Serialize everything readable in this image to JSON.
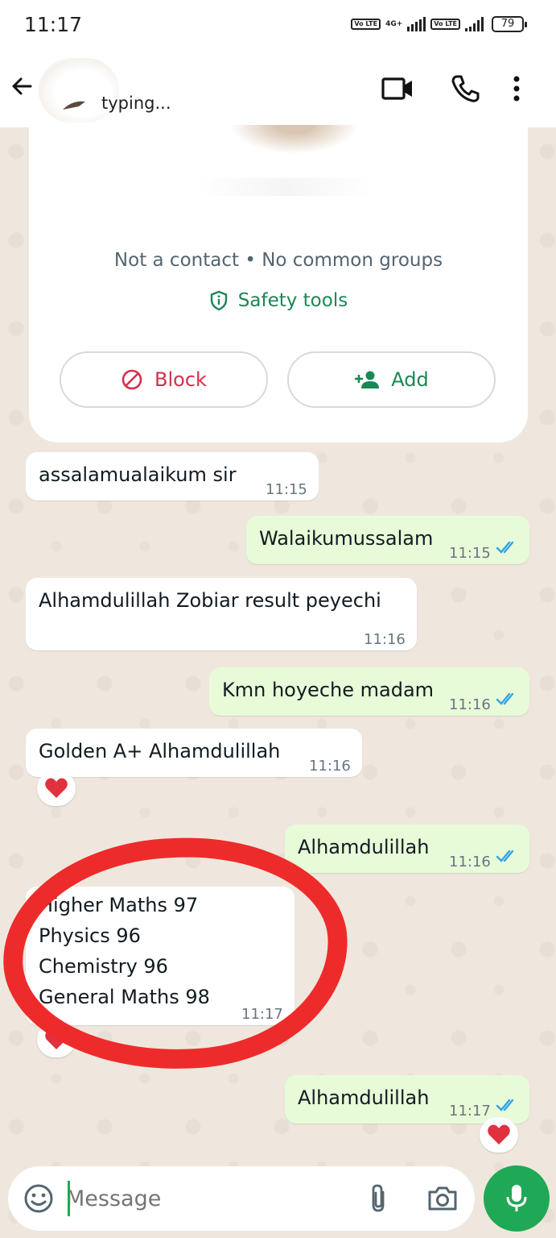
{
  "status_bar": {
    "time": "11:17",
    "network_label": "4G+",
    "volte_label_1": "Vo LTE",
    "volte_label_2": "Vo LTE",
    "battery": "79"
  },
  "header": {
    "contact_status": "typing..."
  },
  "profile_card": {
    "meta_text": "Not a contact • No common groups",
    "safety_tools_label": "Safety tools",
    "block_label": "Block",
    "add_label": "Add"
  },
  "messages": [
    {
      "direction": "in",
      "text": "assalamualaikum sir",
      "time": "11:15"
    },
    {
      "direction": "out",
      "text": "Walaikumussalam",
      "time": "11:15",
      "status": "read"
    },
    {
      "direction": "in",
      "text": "Alhamdulillah Zobiar result peyechi",
      "time": "11:16"
    },
    {
      "direction": "out",
      "text": "Kmn hoyeche madam",
      "time": "11:16",
      "status": "read"
    },
    {
      "direction": "in",
      "text": "Golden A+ Alhamdulillah",
      "time": "11:16",
      "reaction": "heart"
    },
    {
      "direction": "out",
      "text": "Alhamdulillah",
      "time": "11:16",
      "status": "read"
    },
    {
      "direction": "in",
      "lines": [
        "Higher Maths 97",
        "Physics 96",
        "Chemistry 96",
        "General Maths 98"
      ],
      "time": "11:17",
      "reaction": "heart"
    },
    {
      "direction": "out",
      "text": "Alhamdulillah",
      "time": "11:17",
      "status": "read",
      "reaction": "heart"
    }
  ],
  "input_bar": {
    "placeholder": "Message"
  },
  "colors": {
    "accent_green": "#1fa855",
    "incoming_bubble": "#ffffff",
    "outgoing_bubble": "#e7fbd8",
    "read_tick": "#34a3e6",
    "block_red": "#d3304a",
    "annotation_red": "#ee2b2b"
  }
}
